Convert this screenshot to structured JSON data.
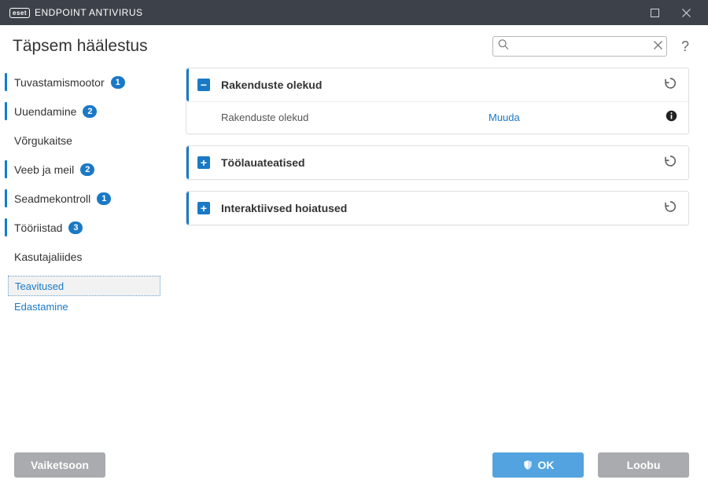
{
  "titlebar": {
    "logo_text": "eset",
    "product_name": "ENDPOINT ANTIVIRUS"
  },
  "header": {
    "title": "Täpsem häälestus",
    "search_placeholder": "",
    "help_label": "?"
  },
  "sidebar": {
    "items": [
      {
        "label": "Tuvastamismootor",
        "badge": "1"
      },
      {
        "label": "Uuendamine",
        "badge": "2"
      },
      {
        "label": "Võrgukaitse",
        "badge": null
      },
      {
        "label": "Veeb ja meil",
        "badge": "2"
      },
      {
        "label": "Seadmekontroll",
        "badge": "1"
      },
      {
        "label": "Tööriistad",
        "badge": "3"
      },
      {
        "label": "Kasutajaliides",
        "badge": null
      }
    ],
    "sub": [
      {
        "label": "Teavitused",
        "selected": true
      },
      {
        "label": "Edastamine",
        "selected": false
      }
    ]
  },
  "panels": [
    {
      "id": "app_states",
      "expanded": true,
      "title": "Rakenduste olekud",
      "row_label": "Rakenduste olekud",
      "row_action": "Muuda"
    },
    {
      "id": "desktop_notifications",
      "expanded": false,
      "title": "Töölauateatised"
    },
    {
      "id": "interactive_warnings",
      "expanded": false,
      "title": "Interaktiivsed hoiatused"
    }
  ],
  "footer": {
    "default_label": "Vaiketsoon",
    "ok_label": "OK",
    "cancel_label": "Loobu"
  }
}
